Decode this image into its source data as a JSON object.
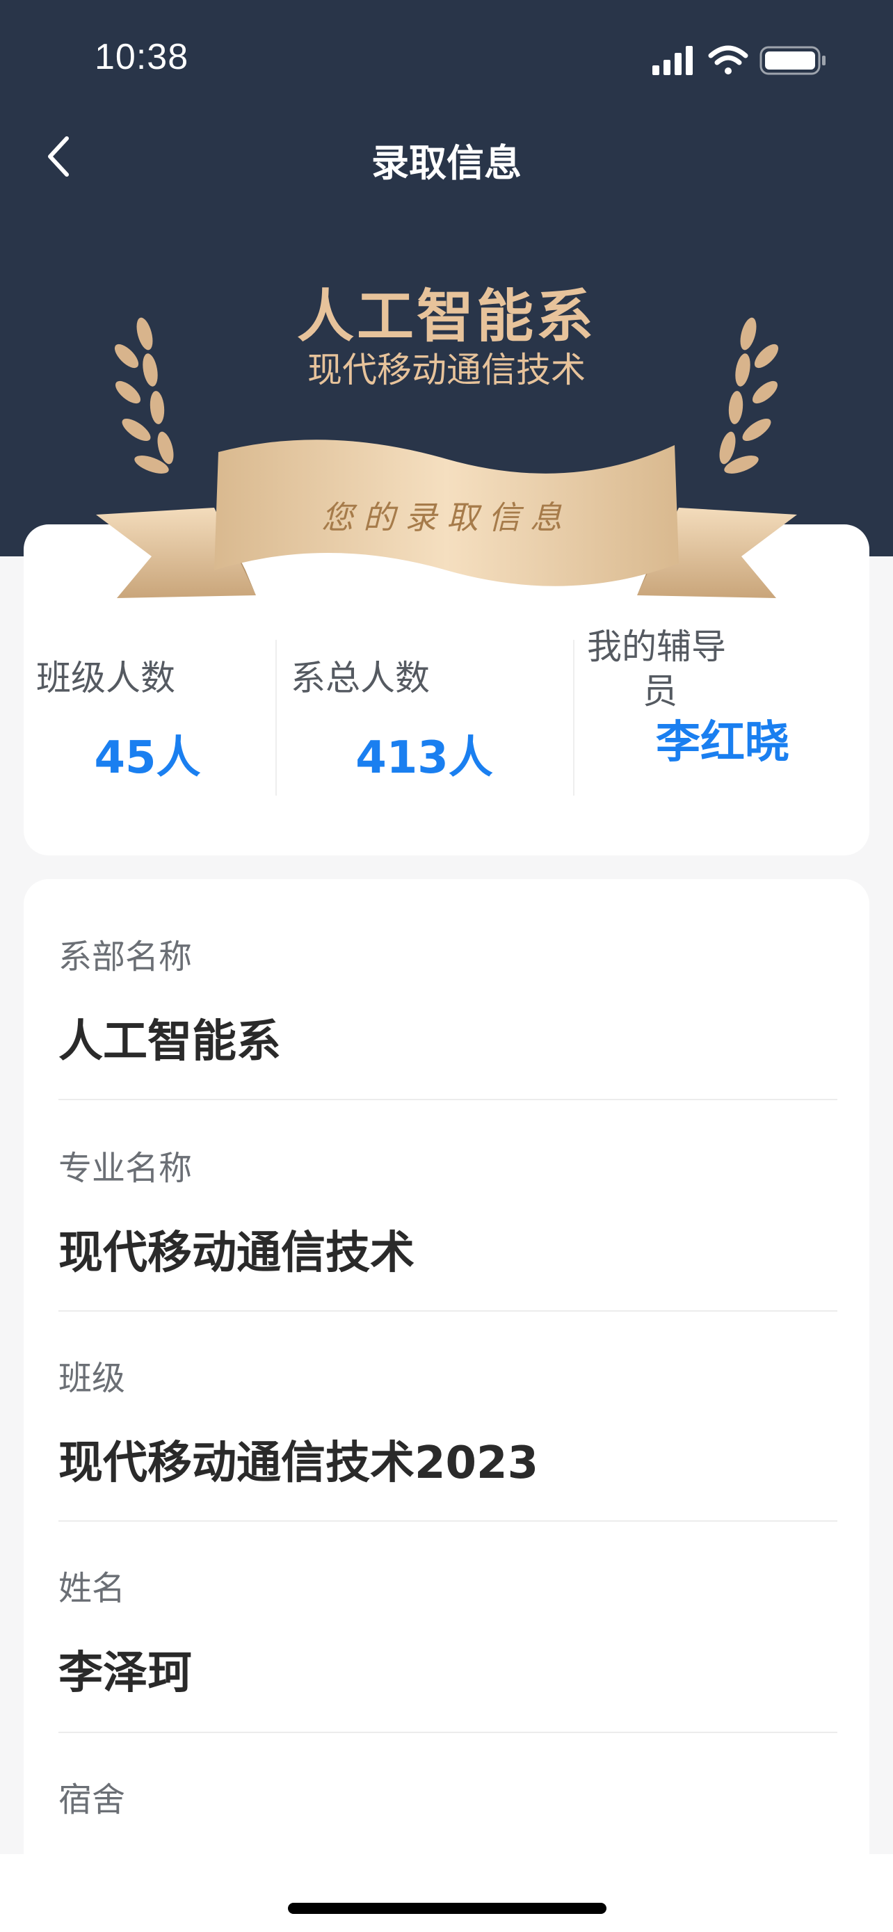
{
  "status_bar": {
    "time": "10:38",
    "battery_icon": "battery-icon",
    "wifi_icon": "wifi-icon",
    "signal_icon": "signal-icon"
  },
  "nav": {
    "title": "录取信息",
    "back_icon": "chevron-left-icon"
  },
  "banner": {
    "department": "人工智能系",
    "major": "现代移动通信技术",
    "ribbon_text": "您的录取信息",
    "gold_color": "#e7c39b",
    "header_color": "#293549"
  },
  "stats": {
    "class_count_label": "班级人数",
    "class_count_value": "45人",
    "dept_count_label": "系总人数",
    "dept_count_value": "413人",
    "counselor_label_line1": "我的辅导",
    "counselor_label_line2": "员",
    "counselor_value": "李红晓",
    "value_color": "#1a7ff0"
  },
  "info": {
    "rows": [
      {
        "label": "系部名称",
        "value": "人工智能系"
      },
      {
        "label": "专业名称",
        "value": "现代移动通信技术"
      },
      {
        "label": "班级",
        "value": "现代移动通信技术2023"
      },
      {
        "label": "姓名",
        "value": "李泽珂"
      },
      {
        "label": "宿舍",
        "value": ""
      }
    ]
  }
}
